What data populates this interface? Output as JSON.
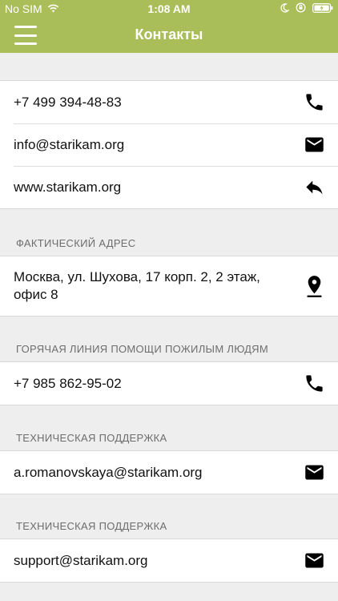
{
  "status_bar": {
    "carrier": "No SIM",
    "time": "1:08 AM"
  },
  "nav": {
    "title": "Контакты",
    "menu_icon": "hamburger-menu-icon"
  },
  "contacts": {
    "phone": "+7 499 394-48-83",
    "email": "info@starikam.org",
    "website": "www.starikam.org"
  },
  "address_section": {
    "header": "ФАКТИЧЕСКИЙ АДРЕС",
    "address": "Москва, ул. Шухова, 17 корп. 2, 2 этаж, офис 8"
  },
  "hotline_section": {
    "header": "ГОРЯЧАЯ ЛИНИЯ ПОМОЩИ ПОЖИЛЫМ ЛЮДЯМ",
    "phone": "+7 985 862-95-02"
  },
  "tech_support_1": {
    "header": "ТЕХНИЧЕСКАЯ ПОДДЕРЖКА",
    "email": "a.romanovskaya@starikam.org"
  },
  "tech_support_2": {
    "header": "ТЕХНИЧЕСКАЯ ПОДДЕРЖКА",
    "email": "support@starikam.org"
  },
  "colors": {
    "brand": "#a9bd58",
    "background": "#eeeeee"
  }
}
